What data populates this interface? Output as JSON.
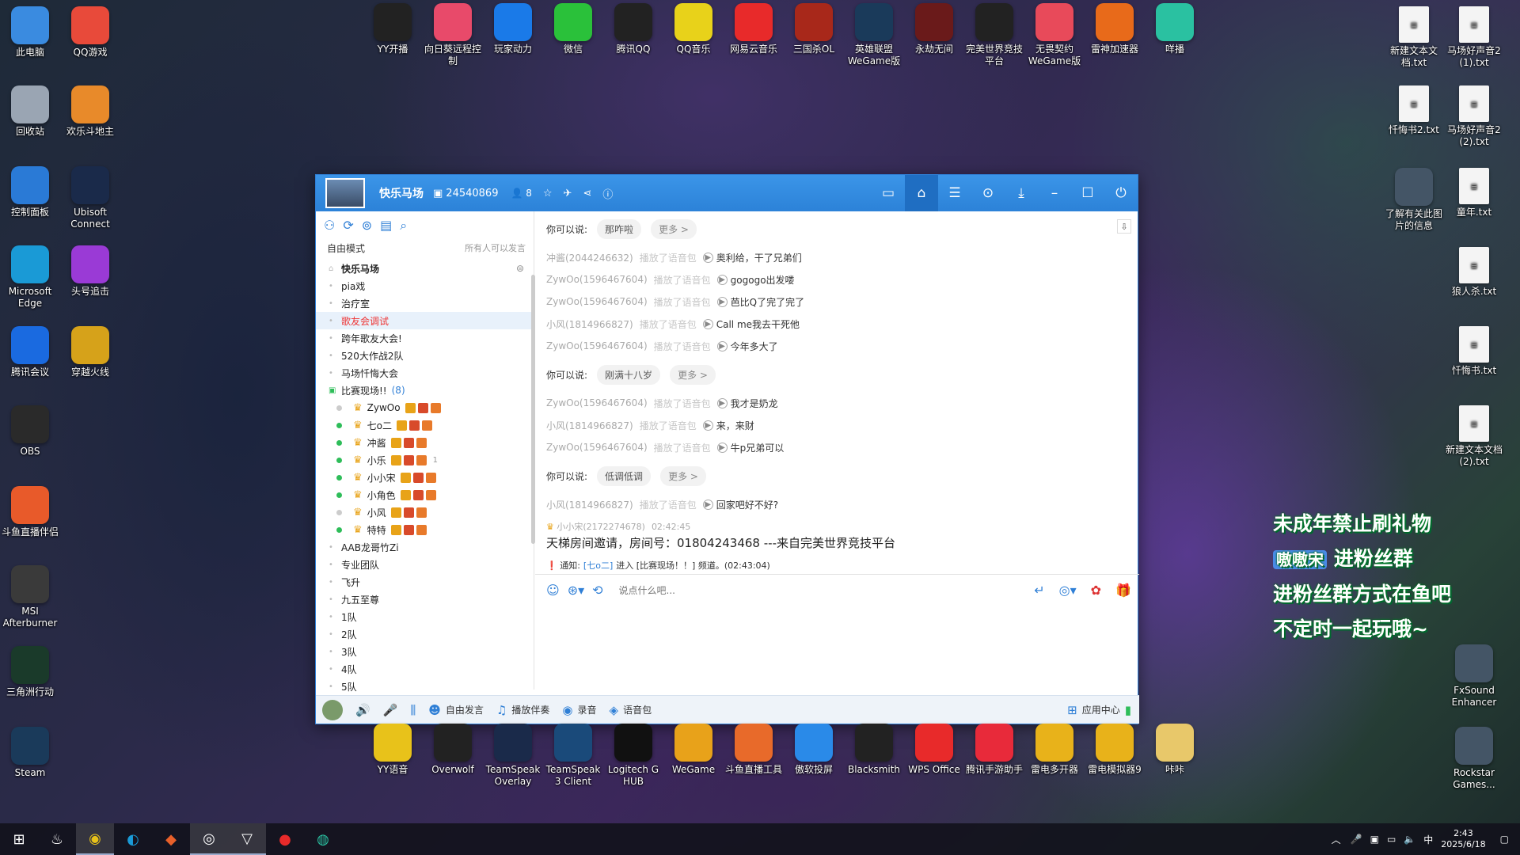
{
  "desktop_left": [
    {
      "label": "此电脑",
      "icon": "computer-icon",
      "color": "#3a8be0"
    },
    {
      "label": "QQ游戏",
      "icon": "qq-game-icon",
      "color": "#e84a3a"
    },
    {
      "label": "回收站",
      "icon": "recycle-bin-icon",
      "color": "#9aa5b3"
    },
    {
      "label": "欢乐斗地主",
      "icon": "landlord-game-icon",
      "color": "#e88a2a"
    },
    {
      "label": "控制面板",
      "icon": "control-panel-icon",
      "color": "#2a7ad6"
    },
    {
      "label": "Ubisoft Connect",
      "icon": "ubisoft-icon",
      "color": "#1a2a4a"
    },
    {
      "label": "Microsoft Edge",
      "icon": "edge-icon",
      "color": "#1a9ad6"
    },
    {
      "label": "头号追击",
      "icon": "game-icon",
      "color": "#9a3ad6"
    },
    {
      "label": "腾讯会议",
      "icon": "tencent-meeting-icon",
      "color": "#1a6ae0"
    },
    {
      "label": "穿越火线",
      "icon": "crossfire-icon",
      "color": "#d6a21a"
    },
    {
      "label": "OBS",
      "icon": "obs-icon",
      "color": "#2a2a2a"
    },
    {
      "label": "斗鱼直播伴侣",
      "icon": "douyu-icon",
      "color": "#e85a2a"
    },
    {
      "label": "MSI Afterburner",
      "icon": "msi-icon",
      "color": "#3a3a3a"
    },
    {
      "label": "三角洲行动",
      "icon": "delta-force-icon",
      "color": "#1a3a2a"
    },
    {
      "label": "Steam",
      "icon": "steam-icon",
      "color": "#1a3a5a"
    }
  ],
  "desktop_top": [
    {
      "label": "YY开播",
      "icon": "yy-live-icon",
      "color": "#222"
    },
    {
      "label": "向日葵远程控制",
      "icon": "sunflower-remote-icon",
      "color": "#e84a6a"
    },
    {
      "label": "玩家动力",
      "icon": "player-power-icon",
      "color": "#1a7ae8"
    },
    {
      "label": "微信",
      "icon": "wechat-icon",
      "color": "#2ac13a"
    },
    {
      "label": "腾讯QQ",
      "icon": "qq-icon",
      "color": "#222"
    },
    {
      "label": "QQ音乐",
      "icon": "qq-music-icon",
      "color": "#e8d21a"
    },
    {
      "label": "网易云音乐",
      "icon": "netease-music-icon",
      "color": "#e82a2a"
    },
    {
      "label": "三国杀OL",
      "icon": "sanguosha-icon",
      "color": "#a8281a"
    },
    {
      "label": "英雄联盟 WeGame版",
      "icon": "lol-icon",
      "color": "#1a3a5a"
    },
    {
      "label": "永劫无间",
      "icon": "naraka-icon",
      "color": "#6a1a1a"
    },
    {
      "label": "完美世界竞技平台",
      "icon": "perfect-world-icon",
      "color": "#222"
    },
    {
      "label": "无畏契约 WeGame版",
      "icon": "valorant-icon",
      "color": "#e84a5a"
    },
    {
      "label": "雷神加速器",
      "icon": "leishen-icon",
      "color": "#e86a1a"
    },
    {
      "label": "咩播",
      "icon": "miebo-icon",
      "color": "#2ac1a1"
    }
  ],
  "desktop_right": [
    {
      "label": "新建文本文档.txt",
      "icon": "text-file-icon"
    },
    {
      "label": "马场好声音2 (1).txt",
      "icon": "text-file-icon"
    },
    {
      "label": "忏悔书2.txt",
      "icon": "text-file-icon"
    },
    {
      "label": "马场好声音2 (2).txt",
      "icon": "text-file-icon"
    },
    {
      "label": "了解有关此图片的信息",
      "icon": "info-icon"
    },
    {
      "label": "童年.txt",
      "icon": "text-file-icon"
    },
    {
      "label": "狼人杀.txt",
      "icon": "text-file-icon"
    },
    {
      "label": "忏悔书.txt",
      "icon": "text-file-icon"
    },
    {
      "label": "新建文本文档 (2).txt",
      "icon": "text-file-icon"
    },
    {
      "label": "FxSound Enhancer",
      "icon": "fxsound-icon"
    },
    {
      "label": "Rockstar Games...",
      "icon": "rockstar-icon"
    }
  ],
  "desktop_bottom": [
    {
      "label": "YY语音",
      "icon": "yy-voice-icon",
      "color": "#e8c21a"
    },
    {
      "label": "Overwolf",
      "icon": "overwolf-icon",
      "color": "#222"
    },
    {
      "label": "TeamSpeak Overlay",
      "icon": "teamspeak-icon",
      "color": "#1a2a4a"
    },
    {
      "label": "TeamSpeak 3 Client",
      "icon": "teamspeak-icon",
      "color": "#1a4a7a"
    },
    {
      "label": "Logitech G HUB",
      "icon": "logitech-icon",
      "color": "#111"
    },
    {
      "label": "WeGame",
      "icon": "wegame-icon",
      "color": "#e8a21a"
    },
    {
      "label": "斗鱼直播工具",
      "icon": "douyu-icon",
      "color": "#e86a2a"
    },
    {
      "label": "傲软投屏",
      "icon": "apowermirror-icon",
      "color": "#2a8ae8"
    },
    {
      "label": "Blacksmith",
      "icon": "blacksmith-icon",
      "color": "#222"
    },
    {
      "label": "WPS Office",
      "icon": "wps-icon",
      "color": "#e82a2a"
    },
    {
      "label": "腾讯手游助手",
      "icon": "tencent-mobile-icon",
      "color": "#e82a3a"
    },
    {
      "label": "雷电多开器",
      "icon": "ldplayer-multi-icon",
      "color": "#e8b21a"
    },
    {
      "label": "雷电模拟器9",
      "icon": "ldplayer-icon",
      "color": "#e8b21a"
    },
    {
      "label": "咔咔",
      "icon": "folder-icon",
      "color": "#e8c86a"
    }
  ],
  "overlay": {
    "line1": "未成年禁止刷礼物",
    "line2_highlight": "嗷嗷宋",
    "line2_tail": "进粉丝群",
    "line3": "进粉丝群方式在鱼吧",
    "line4": "不定时一起玩哦~"
  },
  "window": {
    "name": "快乐马场",
    "room_id": "24540869",
    "member_count": "8",
    "left_mode": "自由模式",
    "left_mode_note": "所有人可以发言",
    "channels": [
      {
        "label": "快乐马场",
        "kind": "root"
      },
      {
        "label": "pia戏"
      },
      {
        "label": "治疗室"
      },
      {
        "label": "歌友会调试",
        "kind": "selected"
      },
      {
        "label": "跨年歌友大会!"
      },
      {
        "label": "520大作战2队"
      },
      {
        "label": "马场忏悔大会"
      },
      {
        "label": "比赛现场!!",
        "count": "(8)",
        "kind": "open"
      }
    ],
    "members": [
      {
        "name": "ZywOo",
        "online": false
      },
      {
        "name": "七o二",
        "online": true
      },
      {
        "name": "冲酱",
        "online": true
      },
      {
        "name": "小乐",
        "online": true,
        "extra": "1"
      },
      {
        "name": "小小宋",
        "online": true
      },
      {
        "name": "小角色",
        "online": true
      },
      {
        "name": "小风",
        "online": false
      },
      {
        "name": "特特",
        "online": true
      }
    ],
    "channels_after": [
      {
        "label": "AAB龙哥竹Zi"
      },
      {
        "label": "专业团队"
      },
      {
        "label": "飞升"
      },
      {
        "label": "九五至尊"
      },
      {
        "label": "1队"
      },
      {
        "label": "2队"
      },
      {
        "label": "3队"
      },
      {
        "label": "4队"
      },
      {
        "label": "5队"
      }
    ],
    "you_can_say": "你可以说:",
    "more": "更多 >",
    "voice_action": "播放了语音包",
    "blocks": [
      {
        "suggest": "那咋啦",
        "msgs": [
          {
            "who": "冲酱(2044246632)",
            "text": "奥利给，干了兄弟们"
          },
          {
            "who": "ZywOo(1596467604)",
            "text": "gogogo出发喽"
          },
          {
            "who": "ZywOo(1596467604)",
            "text": "芭比Q了完了完了"
          },
          {
            "who": "小风(1814966827)",
            "text": "Call me我去干死他"
          },
          {
            "who": "ZywOo(1596467604)",
            "text": "今年多大了"
          }
        ]
      },
      {
        "suggest": "刚满十八岁",
        "msgs": [
          {
            "who": "ZywOo(1596467604)",
            "text": "我才是奶龙"
          },
          {
            "who": "小风(1814966827)",
            "text": "来，来财"
          },
          {
            "who": "ZywOo(1596467604)",
            "text": "牛p兄弟可以"
          }
        ]
      },
      {
        "suggest": "低调低调",
        "msgs": [
          {
            "who": "小风(1814966827)",
            "text": "回家吧好不好?"
          }
        ]
      }
    ],
    "chat_msg": {
      "who": "小小宋(2172274678)",
      "time": "02:42:45",
      "text": "天梯房间邀请，房间号：01804243468 ---来自完美世界竞技平台"
    },
    "notice": {
      "prefix": "通知:",
      "user": "[七o二]",
      "mid": "进入 [比赛现场！！] 频道。",
      "time": "(02:43:04)"
    },
    "input_placeholder": "说点什么吧...",
    "bottom": [
      "自由发言",
      "播放伴奏",
      "录音",
      "语音包"
    ],
    "app_center": "应用中心"
  },
  "taskbar": {
    "time": "2:43",
    "date": "2025/6/18",
    "lang": "中"
  }
}
